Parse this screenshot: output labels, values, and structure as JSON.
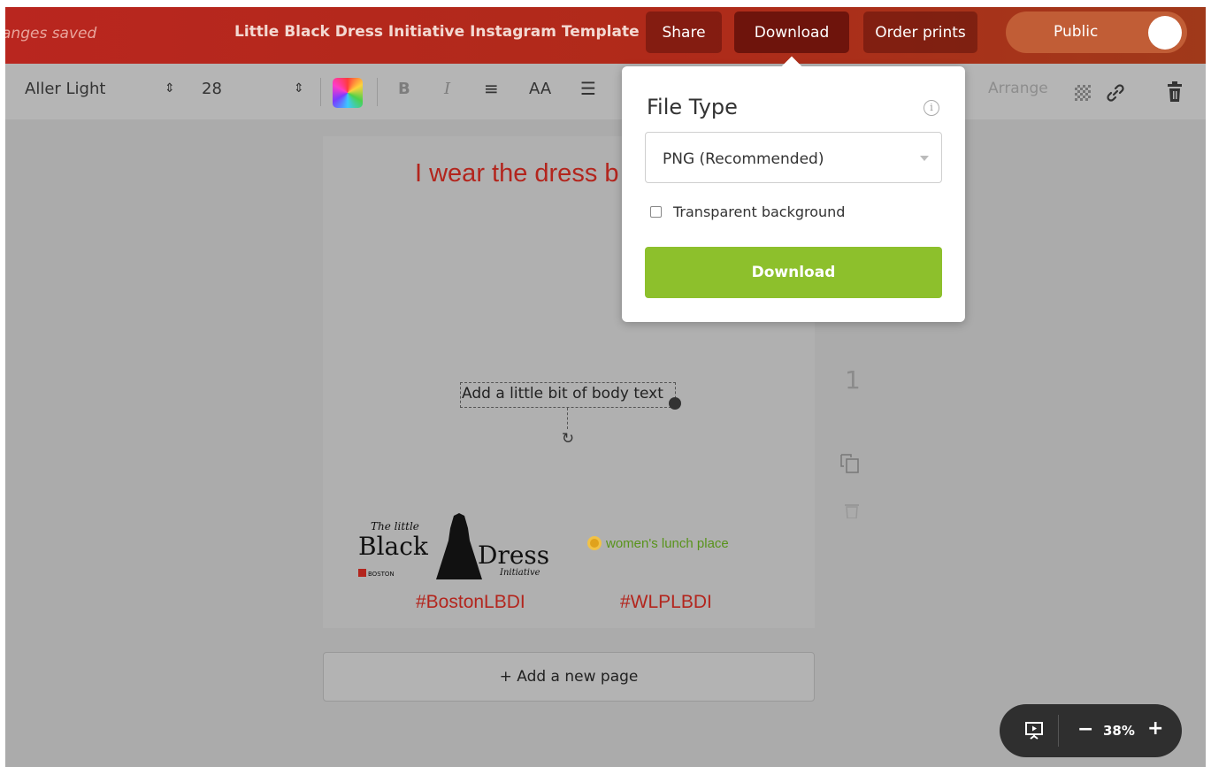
{
  "header": {
    "save_status": "anges saved",
    "document_title": "Little Black Dress Initiative Instagram Template",
    "share_label": "Share",
    "download_label": "Download",
    "order_prints_label": "Order prints",
    "public_toggle_label": "Public"
  },
  "toolbar": {
    "font_family": "Aller Light",
    "font_size": "28",
    "spinner_glyph": "⇕",
    "bold_label": "B",
    "italic_label": "I",
    "align_glyph": "≡",
    "case_label": "AA",
    "list_glyph": "☰",
    "arrange_label": "Arrange"
  },
  "download_popover": {
    "title": "File Type",
    "info_glyph": "i",
    "file_type_selected": "PNG (Recommended)",
    "transparent_label": "Transparent background",
    "download_button_label": "Download"
  },
  "canvas": {
    "headline": "I wear the dress b",
    "body_text": "Add a little bit of body text",
    "logo_the_little": "The little",
    "logo_black": "Black",
    "logo_dress": "Dress",
    "logo_initiative": "Initiative",
    "logo_boston": "BOSTON",
    "partner_logo_text": "women's lunch place",
    "hashtag_left": "#BostonLBDI",
    "hashtag_right": "#WLPLBDI",
    "add_page_label": "+ Add a new page",
    "page_number": "1"
  },
  "zoom": {
    "minus_label": "−",
    "level": "38%",
    "plus_label": "+"
  },
  "colors": {
    "header": "#b9261f",
    "download_green": "#8dc02c",
    "hashtag_red": "#b3251d",
    "partner_green": "#58931b"
  }
}
